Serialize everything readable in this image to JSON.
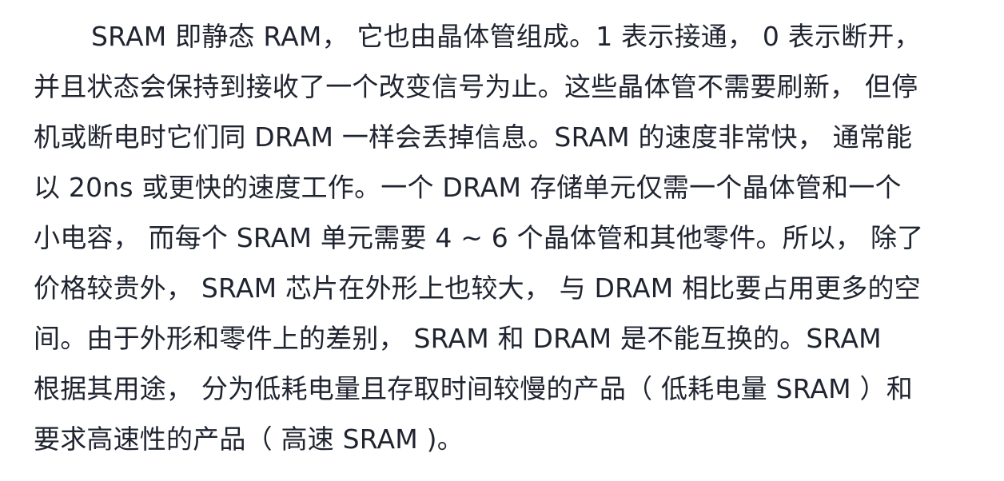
{
  "document": {
    "paragraph_lines": [
      "SRAM 即静态 RAM， 它也由晶体管组成。1 表示接通， 0 表示断开，",
      "并且状态会保持到接收了一个改变信号为止。这些晶体管不需要刷新， 但停",
      "机或断电时它们同 DRAM 一样会丢掉信息。SRAM 的速度非常快， 通常能",
      "以 20ns 或更快的速度工作。一个 DRAM 存储单元仅需一个晶体管和一个",
      "小电容， 而每个 SRAM 单元需要 4 ~ 6 个晶体管和其他零件。所以， 除了",
      "价格较贵外， SRAM 芯片在外形上也较大， 与 DRAM 相比要占用更多的空",
      "间。由于外形和零件上的差别， SRAM 和 DRAM 是不能互换的。SRAM",
      "根据其用途， 分为低耗电量且存取时间较慢的产品（ 低耗电量 SRAM ）和",
      "要求高速性的产品（ 高速 SRAM )。"
    ]
  }
}
